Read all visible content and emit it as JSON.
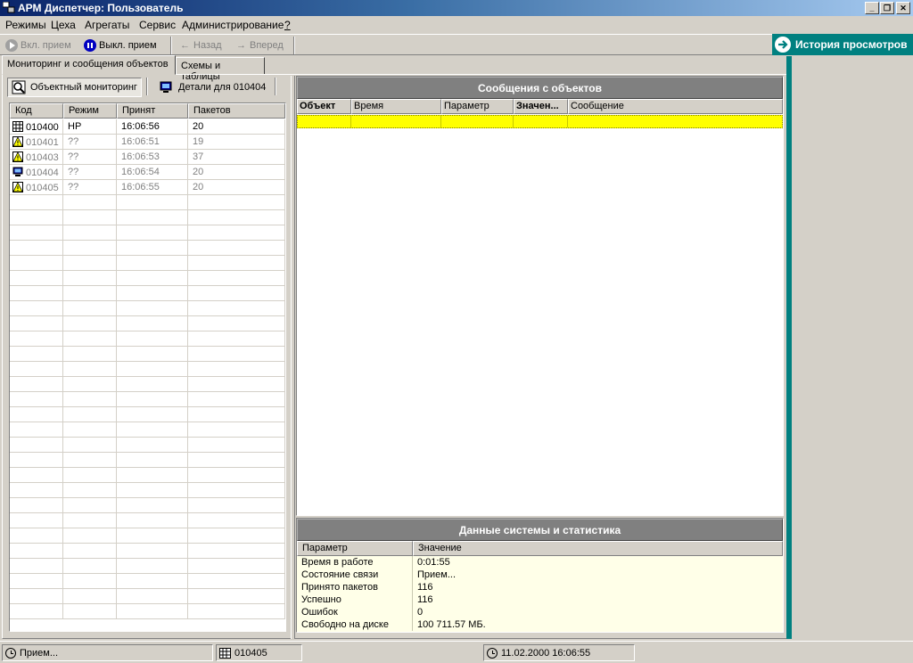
{
  "window": {
    "title": "АРМ Диспетчер: Пользователь"
  },
  "menu": [
    "Режимы",
    "Цеха",
    "Агрегаты",
    "Сервис",
    "Администрирование",
    "?"
  ],
  "toolbar": {
    "start_receive": "Вкл. прием",
    "stop_receive": "Выкл. прием",
    "back": "Назад",
    "forward": "Вперед"
  },
  "tabs": [
    "Мониторинг и сообщения объектов",
    "Схемы и таблицы"
  ],
  "subtoolbar": {
    "object_monitoring": "Объектный мониторинг",
    "details": "Детали для 010404"
  },
  "objects_table": {
    "columns": [
      "Код",
      "Режим",
      "Принят",
      "Пакетов"
    ],
    "rows": [
      {
        "code": "010400",
        "mode": "НР",
        "received": "16:06:56",
        "packets": "20",
        "icon": "table-icon",
        "gray": false
      },
      {
        "code": "010401",
        "mode": "??",
        "received": "16:06:51",
        "packets": "19",
        "icon": "warning-icon",
        "gray": true
      },
      {
        "code": "010403",
        "mode": "??",
        "received": "16:06:53",
        "packets": "37",
        "icon": "warning-icon",
        "gray": true
      },
      {
        "code": "010404",
        "mode": "??",
        "received": "16:06:54",
        "packets": "20",
        "icon": "monitor-icon",
        "gray": true
      },
      {
        "code": "010405",
        "mode": "??",
        "received": "16:06:55",
        "packets": "20",
        "icon": "warning-icon",
        "gray": true
      }
    ]
  },
  "messages": {
    "title": "Сообщения с объектов",
    "columns": [
      "Объект",
      "Время",
      "Параметр",
      "Значен...",
      "Сообщение"
    ]
  },
  "stats": {
    "title": "Данные системы и статистика",
    "columns": [
      "Параметр",
      "Значение"
    ],
    "rows": [
      {
        "param": "Время в работе",
        "value": "0:01:55"
      },
      {
        "param": "Состояние связи",
        "value": "Прием..."
      },
      {
        "param": "Принято пакетов",
        "value": "116"
      },
      {
        "param": "Успешно",
        "value": "116"
      },
      {
        "param": "Ошибок",
        "value": "0"
      },
      {
        "param": "Свободно на диске",
        "value": "100 711.57 МБ."
      }
    ]
  },
  "history": {
    "title": "История просмотров"
  },
  "status": {
    "state": "Прием...",
    "object": "010405",
    "datetime": "11.02.2000 16:06:55"
  },
  "colors": {
    "accent_teal": "#008080",
    "selected_row": "#ffff00",
    "title_bar": "#0a246a"
  }
}
